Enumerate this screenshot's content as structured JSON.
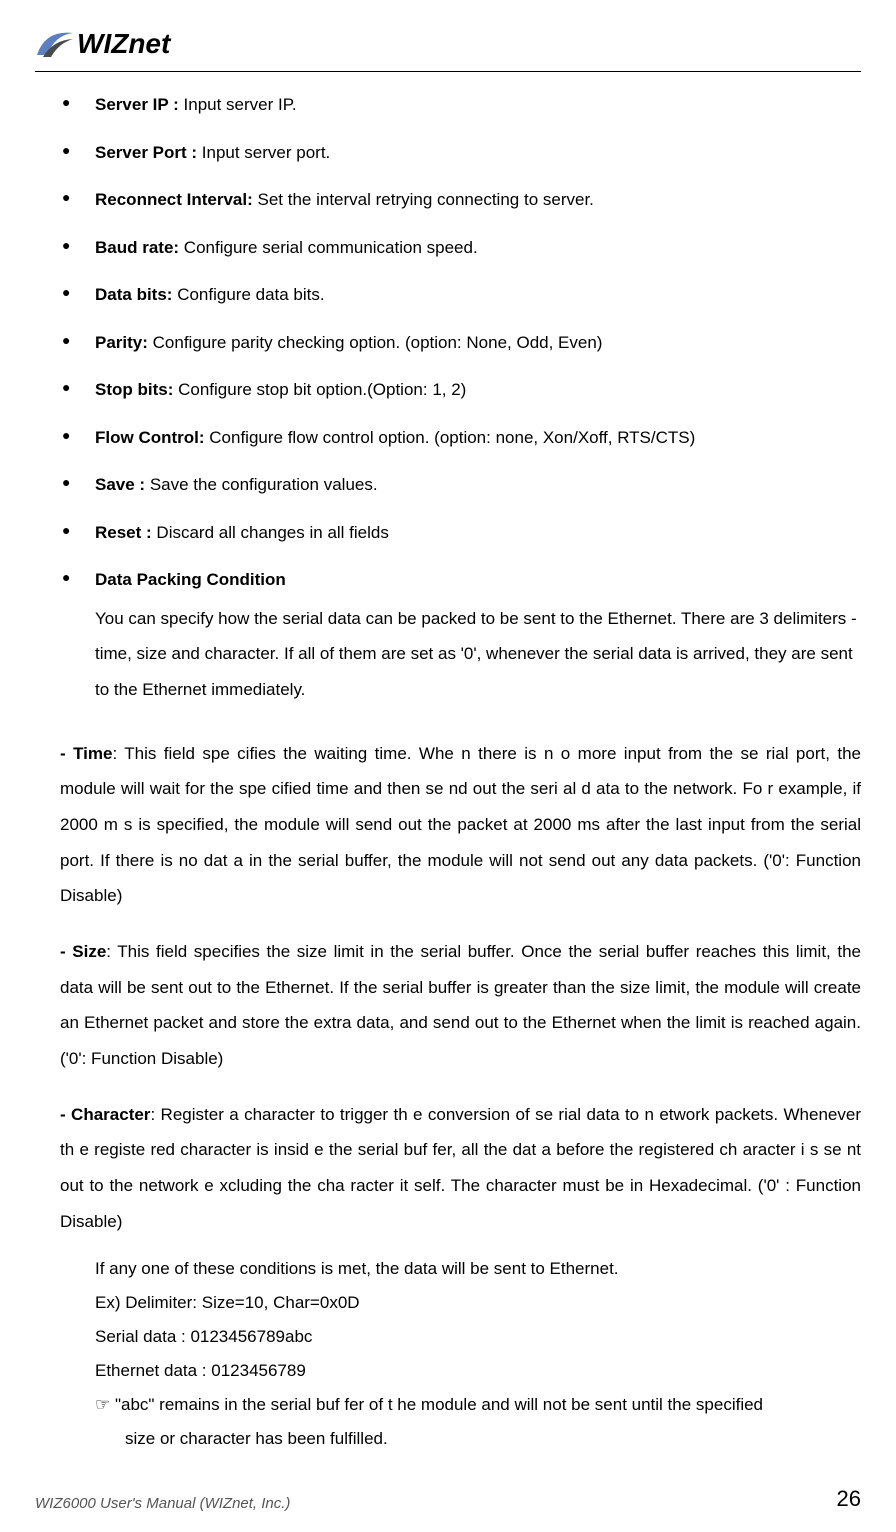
{
  "logo": {
    "text_part1": "W",
    "text_part2": "IZnet"
  },
  "bullets": [
    {
      "label": "Server IP :",
      "desc": " Input server IP."
    },
    {
      "label": "Server Port :",
      "desc": " Input server port."
    },
    {
      "label": "Reconnect Interval:",
      "desc": " Set the interval retrying connecting to server."
    },
    {
      "label": "Baud rate:",
      "desc": " Configure serial communication speed."
    },
    {
      "label": "Data bits:",
      "desc": " Configure data bits."
    },
    {
      "label": "Parity:",
      "desc": " Configure parity checking option. (option: None, Odd, Even)"
    },
    {
      "label": "Stop bits:",
      "desc": " Configure stop bit option.(Option: 1, 2)"
    },
    {
      "label": "Flow Control:",
      "desc": " Configure flow control option. (option: none, Xon/Xoff, RTS/CTS)"
    },
    {
      "label": "Save :",
      "desc": " Save the configuration values."
    },
    {
      "label": "Reset :",
      "desc": " Discard all changes in all fields"
    }
  ],
  "packing": {
    "label": "Data Packing Condition",
    "desc": "You can specify how the serial data can be packed to be sent to the Ethernet. There are 3 delimiters - time, size and character. If all of them are set as '0', whenever the serial data is arrived, they are sent to the Ethernet immediately."
  },
  "time": {
    "prefix": "- Time",
    "text": ": This field spe cifies the waiting time. Whe n there is n o more input from the se rial port, the module   will wait for   the spe cified time and then se   nd out  the seri  al d ata to the  network. Fo r  example, if 2000 m  s is  specified,  the module will   send  out the  packet at 2000 ms after the last input from the serial port. If there is no dat a in the serial buffer, the module will not send out any data packets.    ('0': Function Disable)"
  },
  "size": {
    "prefix": "- Size",
    "text": ": This field specifies the size limit in the serial buffer. Once the serial buffer reaches this limit, the data will be sent out to the Ethernet. If the serial buffer is greater than the size limit, the module will create an Ethernet packet and store the extra data, and send out to the Ethernet when the limit is reached again.    ('0': Function Disable)"
  },
  "character": {
    "prefix": "- Character",
    "text": ": Register a character to trigger th e conversion of se rial data to n etwork packets. Whenever th e registe red character is insid e the serial buf fer, all the dat a before the registered ch aracter i s se nt out to the network e    xcluding the  cha racter it self. The character must be in Hexadecimal.    ('0' : Function Disable)"
  },
  "example": {
    "line1": "If any one of these conditions is met, the data will be sent to Ethernet.",
    "line2": "Ex) Delimiter: Size=10, Char=0x0D",
    "line3": "Serial data : 0123456789abc",
    "line4": "Ethernet data : 0123456789",
    "line5": "☞ \"abc\" remains in the serial buf fer of t he module and will not be sent until the specified",
    "line6": "size or character has been fulfilled."
  },
  "footer": {
    "left": "WIZ6000 User's Manual (WIZnet, Inc.)",
    "right": "26"
  }
}
